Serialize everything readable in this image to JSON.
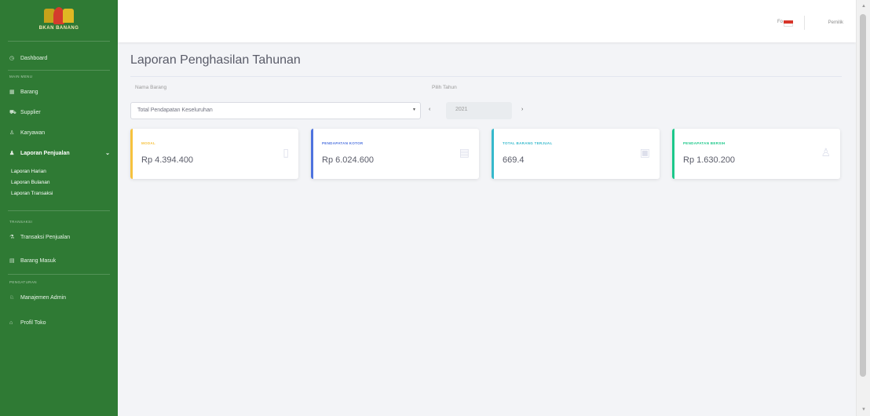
{
  "sidebar": {
    "brand": "BKAN BANANG",
    "items": [
      {
        "icon": "gauge-icon",
        "label": "Dashboard"
      },
      {
        "icon": "box-icon",
        "label": "Barang"
      },
      {
        "icon": "truck-icon",
        "label": "Supplier"
      },
      {
        "icon": "users-icon",
        "label": "Karyawan"
      }
    ],
    "active_item": "Laporan Penjualan",
    "submenu": [
      "Laporan Harian",
      "Laporan Bulanan",
      "Laporan Transaksi"
    ],
    "items2": [
      {
        "icon": "cart-icon",
        "label": "Transaksi Penjualan"
      },
      {
        "icon": "inbox-icon",
        "label": "Barang Masuk"
      },
      {
        "icon": "users-cog-icon",
        "label": "Manajemen Admin"
      },
      {
        "icon": "store-icon",
        "label": "Profil Toko"
      }
    ],
    "section_labels": [
      "MAIN MENU",
      "TRANSAKSI",
      "PENGATURAN"
    ]
  },
  "topbar": {
    "flag_prefix": "Fo",
    "user_name": "Pemilik"
  },
  "main": {
    "title": "Laporan Penghasilan Tahunan",
    "barang_label": "Nama Barang",
    "barang_value": "Total Pendapatan Keseluruhan",
    "tahun_label": "Pilih Tahun",
    "tahun_value": "2021",
    "prev_glyph": "‹",
    "next_glyph": "›"
  },
  "cards": [
    {
      "caption": "MODAL",
      "value": "Rp 4.394.400",
      "icon": "document-icon"
    },
    {
      "caption": "PENDAPATAN KOTOR",
      "value": "Rp 6.024.600",
      "icon": "calendar-icon"
    },
    {
      "caption": "TOTAL BARANG TERJUAL",
      "value": "669.4",
      "icon": "clipboard-icon"
    },
    {
      "caption": "PENDAPATAN BERSIH",
      "value": "Rp 1.630.200",
      "icon": "user-icon"
    }
  ],
  "colors": {
    "sidebar": "#2f7a34",
    "card_modal": "#f6c23e",
    "card_kotor": "#4e73df",
    "card_terjual": "#36b9cc",
    "card_bersih": "#1cc88a"
  }
}
